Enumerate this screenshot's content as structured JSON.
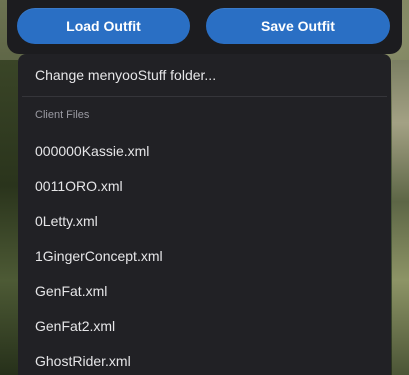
{
  "buttons": {
    "load_label": "Load Outfit",
    "save_label": "Save Outfit",
    "color": "#2a6fc4"
  },
  "menu": {
    "change_folder_label": "Change menyooStuff folder...",
    "section_label": "Client Files",
    "files": [
      "000000Kassie.xml",
      "0011ORO.xml",
      "0Letty.xml",
      "1GingerConcept.xml",
      "GenFat.xml",
      "GenFat2.xml",
      "GhostRider.xml"
    ]
  }
}
